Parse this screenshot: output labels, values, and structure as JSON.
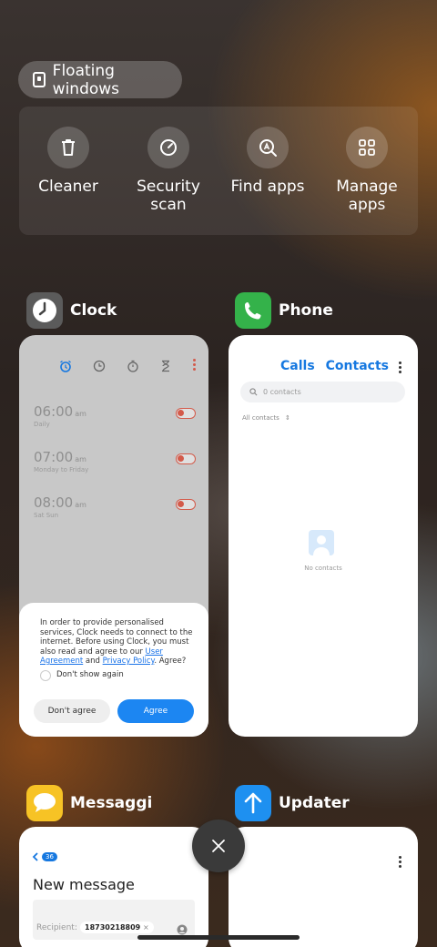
{
  "floating_windows": {
    "label": "Floating windows"
  },
  "tools": [
    {
      "label": "Cleaner",
      "icon": "trash-icon"
    },
    {
      "label": "Security scan",
      "icon": "security-icon"
    },
    {
      "label": "Find apps",
      "icon": "find-apps-icon"
    },
    {
      "label": "Manage apps",
      "icon": "grid-icon"
    }
  ],
  "apps": {
    "clock": {
      "name": "Clock",
      "alarms": [
        {
          "time": "06:00",
          "ampm": "am",
          "days": "Daily"
        },
        {
          "time": "07:00",
          "ampm": "am",
          "days": "Monday to Friday"
        },
        {
          "time": "08:00",
          "ampm": "am",
          "days": "Sat Sun"
        }
      ],
      "dialog": {
        "text_1": "In order to provide personalised services, Clock needs to connect to the internet. Before using Clock, you must also read and agree to our",
        "link_1": "User Agreement",
        "text_2": "and",
        "link_2": "Privacy Policy",
        "text_3": ". Agree?",
        "checkbox_label": "Don't show again",
        "disagree_label": "Don't agree",
        "agree_label": "Agree"
      }
    },
    "phone": {
      "name": "Phone",
      "tab_calls": "Calls",
      "tab_contacts": "Contacts",
      "search_placeholder": "0 contacts",
      "filter_label": "All contacts",
      "empty_text": "No contacts"
    },
    "messaggi": {
      "name": "Messaggi",
      "badge": "36",
      "title": "New message",
      "recipient_label": "Recipient:",
      "recipient_value": "18730218809"
    },
    "updater": {
      "name": "Updater"
    }
  },
  "colors": {
    "accent": "#1c86f2",
    "phone_green": "#34b24a",
    "messaggi_yellow": "#f7c325",
    "updater_blue": "#1e90f0"
  }
}
